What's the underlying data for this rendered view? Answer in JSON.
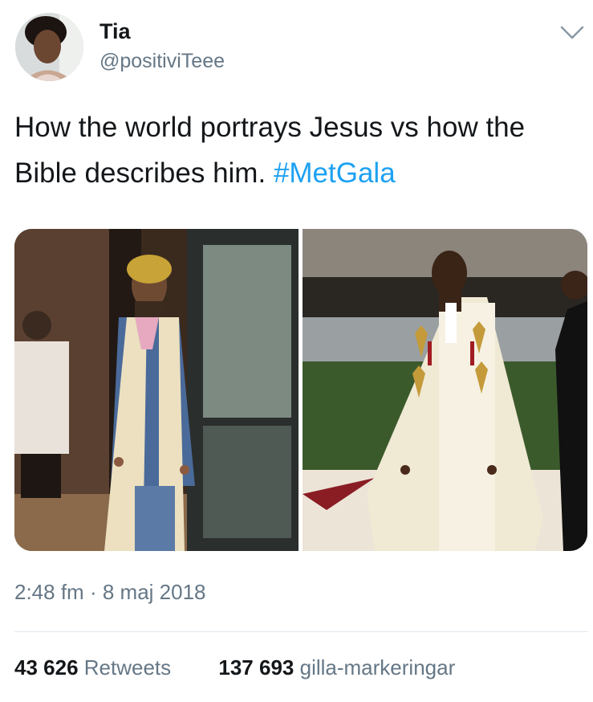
{
  "author": {
    "name": "Tia",
    "handle": "@positiviTeee"
  },
  "tweet": {
    "text": "How the world portrays Jesus vs how the Bible describes him.",
    "hashtag": "#MetGala"
  },
  "meta": {
    "time": "2:48 fm",
    "separator": "·",
    "date": "8 maj 2018"
  },
  "stats": {
    "retweets_count": "43 626",
    "retweets_label": "Retweets",
    "likes_count": "137 693",
    "likes_label": "gilla-markeringar"
  },
  "colors": {
    "link": "#1da1f2",
    "secondary_text": "#657786",
    "divider": "#e1e8ed"
  },
  "icons": {
    "menu": "chevron-down-icon"
  }
}
